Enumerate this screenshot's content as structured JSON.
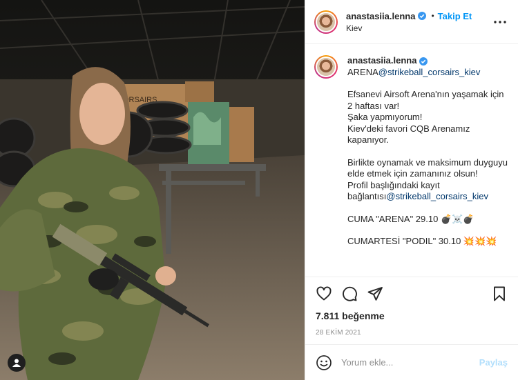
{
  "post": {
    "username": "anastasiia.lenna",
    "location": "Kiev",
    "follow_label": "Takip Et",
    "separator": "•",
    "caption": {
      "username": "anastasiia.lenna",
      "line_first": "ARENA",
      "mention_1": "@strikeball_corsairs_kiev",
      "para1": "Efsanevi Airsoft Arena'nın yaşamak için 2 haftası var!",
      "para2": "Şaka yapmıyorum!",
      "para3": "Kiev'deki favori CQB Arenamız kapanıyor.",
      "para4": "Birlikte oynamak ve maksimum duyguyu elde etmek için zamanınız olsun!",
      "para5_prefix": "Profil başlığındaki kayıt bağlantısı",
      "mention_2": "@strikeball_corsairs_kiev",
      "event_1": "CUMA \"ARENA\" 29.10 💣☠️💣",
      "event_2": "CUMARTESİ \"PODIL\" 30.10 💥💥💥"
    },
    "likes": "7.811 beğenme",
    "date": "28 EKİM 2021",
    "comment_placeholder": "Yorum ekle...",
    "share_label": "Paylaş"
  },
  "icons": {
    "verified": "verified-badge-icon",
    "more": "more-options-icon",
    "like": "heart-icon",
    "comment": "comment-icon",
    "share": "send-icon",
    "save": "bookmark-icon",
    "emoji": "emoji-icon",
    "tags": "user-tag-icon"
  },
  "colors": {
    "accent": "#0095f6",
    "mention": "#00376b",
    "muted": "#8e8e8e",
    "share_disabled": "#b2dffc"
  }
}
